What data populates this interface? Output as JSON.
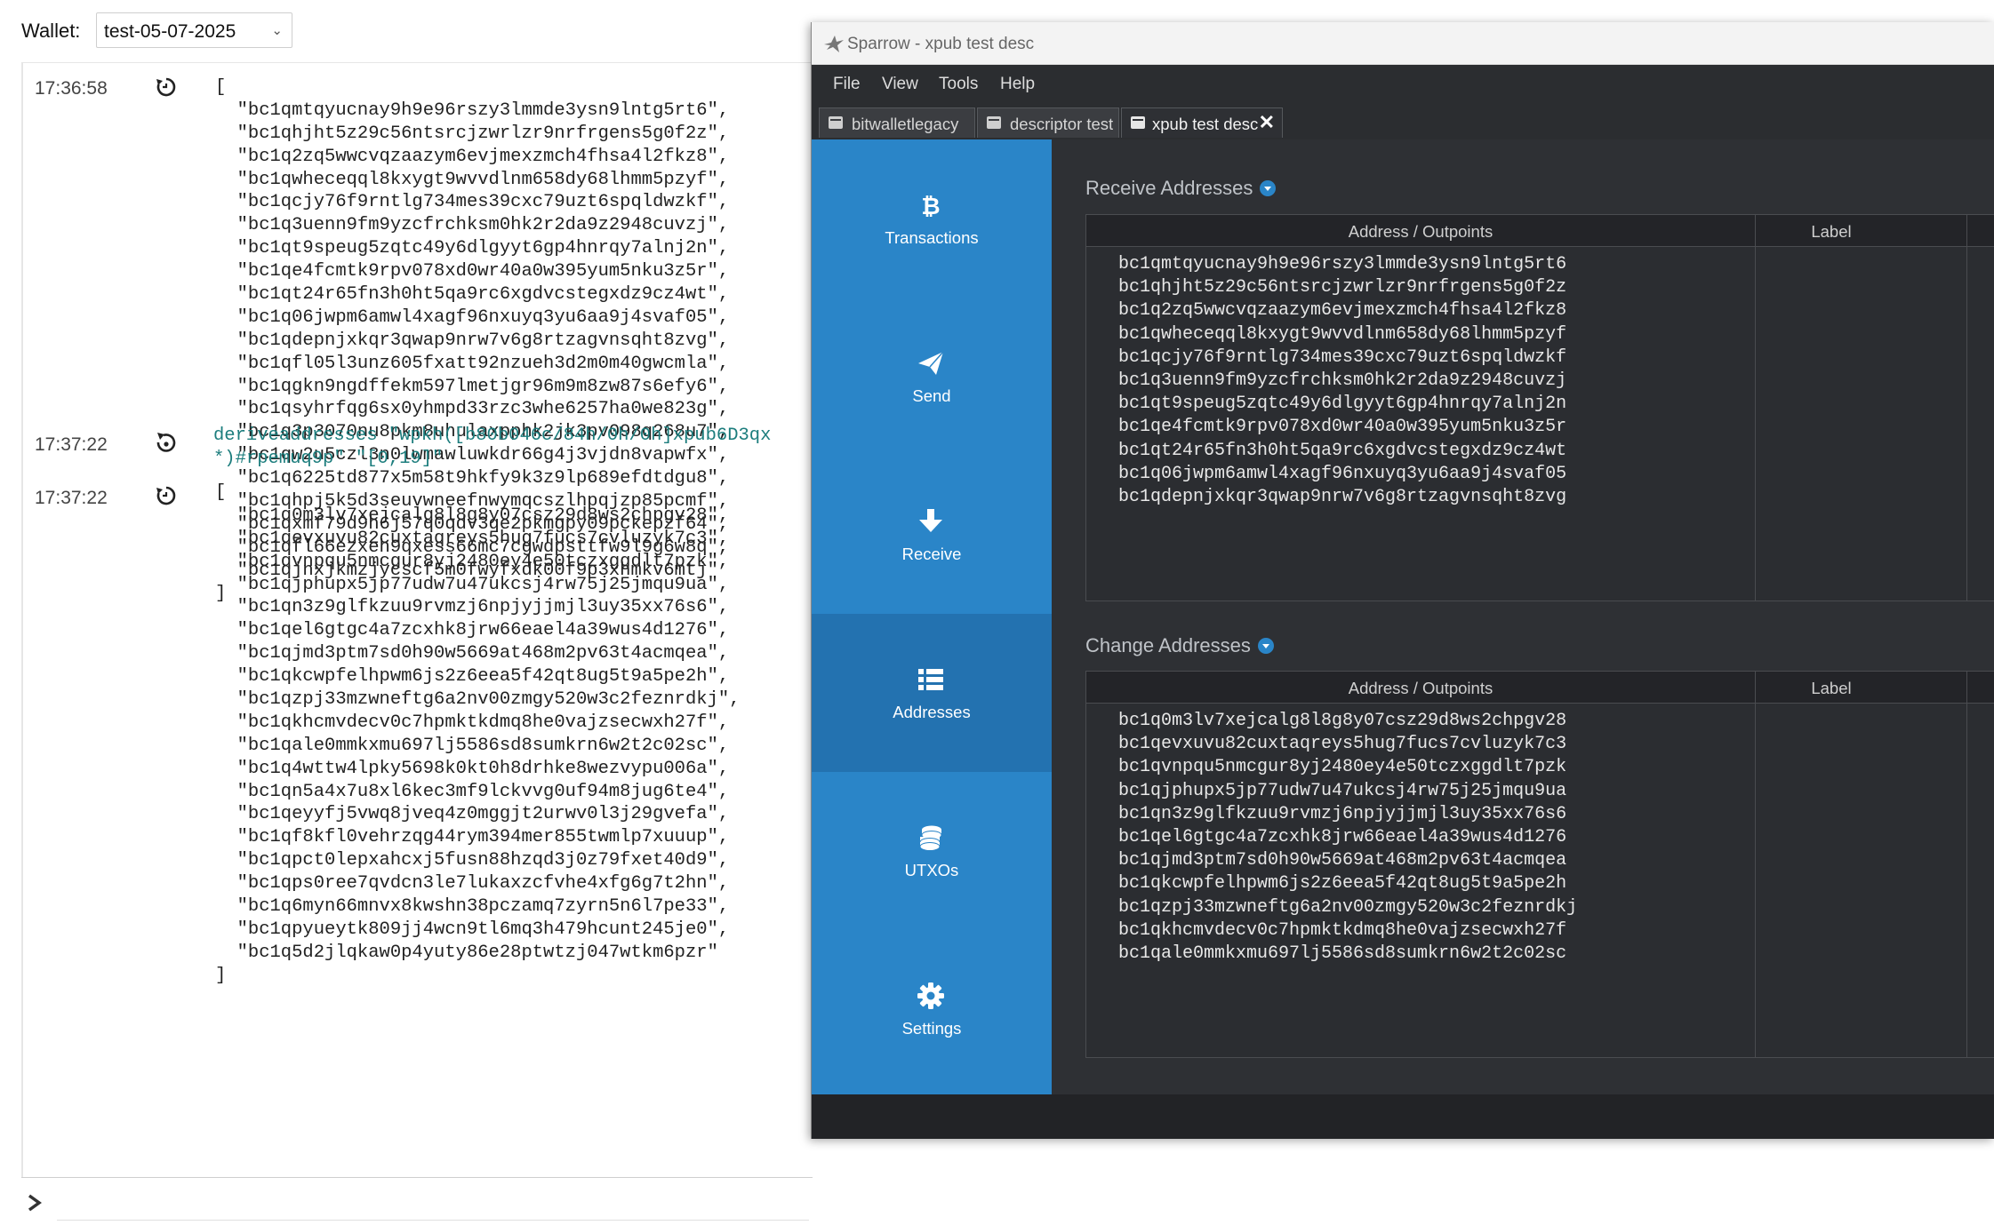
{
  "wallet_bar": {
    "label": "Wallet:",
    "selected_wallet": "test-05-07-2025"
  },
  "console": {
    "entries": [
      {
        "time": "17:36:58",
        "icon": "result-icon",
        "lines": [
          "[",
          "  \"bc1qmtqyucnay9h9e96rszy3lmmde3ysn9lntg5rt6\",",
          "  \"bc1qhjht5z29c56ntsrcjzwrlzr9nrfrgens5g0f2z\",",
          "  \"bc1q2zq5wwcvqzaazym6evjmexzmch4fhsa4l2fkz8\",",
          "  \"bc1qwheceqql8kxygt9wvvdlnm658dy68lhmm5pzyf\",",
          "  \"bc1qcjy76f9rntlg734mes39cxc79uzt6spqldwzkf\",",
          "  \"bc1q3uenn9fm9yzcfrchksm0hk2r2da9z2948cuvzj\",",
          "  \"bc1qt9speug5zqtc49y6dlgyyt6gp4hnrqy7alnj2n\",",
          "  \"bc1qe4fcmtk9rpv078xd0wr40a0w395yum5nku3z5r\",",
          "  \"bc1qt24r65fn3h0ht5qa9rc6xgdvcstegxdz9cz4wt\",",
          "  \"bc1q06jwpm6amwl4xagf96nxuyq3yu6aa9j4svaf05\",",
          "  \"bc1qdepnjxkqr3qwap9nrw7v6g8rtzagvnsqht8zvg\",",
          "  \"bc1qfl05l3unz605fxatt92nzueh3d2m0m40gwcmla\",",
          "  \"bc1qgkn9ngdffekm597lmetjgr96m9m8zw87s6efy6\",",
          "  \"bc1qsyhrfqg6sx0yhmpd33rzc3whe6257ha0we823g\",",
          "  \"bc1q3p3070nu8pkm8uhulaxpphk2jk3pv098q268u7\",",
          "  \"bc1qw2u5czl3n0lwmawluwkdr66g4j3vjdn8vapwfx\",",
          "  \"bc1q6225td877x5m58t9hkfy9k3z9lp689efdtdgu8\",",
          "  \"bc1qhpj5k5d3seuvwneefnwymqcszlhpqjzp85pcmf\",",
          "  \"bc1qxmf79d9h6j57q0qdv3qe2pkmgpy09pckepzf64\",",
          "  \"bc1qfl66ezxeh9qxess66mc7cgwdpsttfw9l9g6w8q\",",
          "  \"bc1qjnxjkmzjycscf5m0fwyfxdk00f9p3xhmkv6mtj\"",
          "]"
        ]
      },
      {
        "time": "17:37:22",
        "icon": "command-icon",
        "command_lines": [
          "deriveaddresses \"wpkh([b80b046c/84h/0h/0h]xpub6D3qx",
          "*)#rpemuq9p\" \"[0,19]\""
        ]
      },
      {
        "time": "17:37:22",
        "icon": "result-icon",
        "lines": [
          "[",
          "  \"bc1q0m3lv7xejcalg8l8g8y07csz29d8ws2chpgv28\",",
          "  \"bc1qevxuvu82cuxtaqreys5hug7fucs7cvluzyk7c3\",",
          "  \"bc1qvnpqu5nmcgur8yj2480ey4e50tczxggdlt7pzk\",",
          "  \"bc1qjphupx5jp77udw7u47ukcsj4rw75j25jmqu9ua\",",
          "  \"bc1qn3z9glfkzuu9rvmzj6npjyjjmjl3uy35xx76s6\",",
          "  \"bc1qel6gtgc4a7zcxhk8jrw66eael4a39wus4d1276\",",
          "  \"bc1qjmd3ptm7sd0h90w5669at468m2pv63t4acmqea\",",
          "  \"bc1qkcwpfelhpwm6js2z6eea5f42qt8ug5t9a5pe2h\",",
          "  \"bc1qzpj33mzwneftg6a2nv00zmgy520w3c2feznrdkj\",",
          "  \"bc1qkhcmvdecv0c7hpmktkdmq8he0vajzsecwxh27f\",",
          "  \"bc1qale0mmkxmu697lj5586sd8sumkrn6w2t2c02sc\",",
          "  \"bc1q4wttw4lpky5698k0kt0h8drhke8wezvypu006a\",",
          "  \"bc1qn5a4x7u8xl6kec3mf9lckvvg0uf94m8jug6te4\",",
          "  \"bc1qeyyfj5vwq8jveq4z0mggjt2urwv0l3j29gvefa\",",
          "  \"bc1qf8kfl0vehrzqg44rym394mer855twmlp7xuuup\",",
          "  \"bc1qpct0lepxahcxj5fusn88hzqd3j0z79fxet40d9\",",
          "  \"bc1qps0ree7qvdcn3le7lukaxzcfvhe4xfg6g7t2hn\",",
          "  \"bc1q6myn66mnvx8kwshn38pczamq7zyrn5n6l7pe33\",",
          "  \"bc1qpyueytk809jj4wcn9tl6mq3h479hcunt245je0\",",
          "  \"bc1q5d2jlqkaw0p4yuty86e28ptwtzj047wtkm6pzr\"",
          "]"
        ]
      }
    ],
    "input_placeholder": ""
  },
  "sparrow": {
    "window_title": "Sparrow - xpub test desc",
    "menu": [
      "File",
      "View",
      "Tools",
      "Help"
    ],
    "tabs": [
      {
        "label": "bitwalletlegacy",
        "active": false
      },
      {
        "label": "descriptor test",
        "active": false
      },
      {
        "label": "xpub test desc",
        "active": true
      }
    ],
    "sidebar": [
      {
        "label": "Transactions",
        "icon": "bitcoin-icon"
      },
      {
        "label": "Send",
        "icon": "send-icon"
      },
      {
        "label": "Receive",
        "icon": "receive-icon"
      },
      {
        "label": "Addresses",
        "icon": "list-icon",
        "active": true
      },
      {
        "label": "UTXOs",
        "icon": "coins-icon"
      },
      {
        "label": "Settings",
        "icon": "gear-icon"
      }
    ],
    "receive": {
      "title": "Receive Addresses",
      "col_address": "Address / Outpoints",
      "col_label": "Label",
      "rows": [
        "bc1qmtqyucnay9h9e96rszy3lmmde3ysn9lntg5rt6",
        "bc1qhjht5z29c56ntsrcjzwrlzr9nrfrgens5g0f2z",
        "bc1q2zq5wwcvqzaazym6evjmexzmch4fhsa4l2fkz8",
        "bc1qwheceqql8kxygt9wvvdlnm658dy68lhmm5pzyf",
        "bc1qcjy76f9rntlg734mes39cxc79uzt6spqldwzkf",
        "bc1q3uenn9fm9yzcfrchksm0hk2r2da9z2948cuvzj",
        "bc1qt9speug5zqtc49y6dlgyyt6gp4hnrqy7alnj2n",
        "bc1qe4fcmtk9rpv078xd0wr40a0w395yum5nku3z5r",
        "bc1qt24r65fn3h0ht5qa9rc6xgdvcstegxdz9cz4wt",
        "bc1q06jwpm6amwl4xagf96nxuyq3yu6aa9j4svaf05",
        "bc1qdepnjxkqr3qwap9nrw7v6g8rtzagvnsqht8zvg"
      ]
    },
    "change": {
      "title": "Change Addresses",
      "col_address": "Address / Outpoints",
      "col_label": "Label",
      "rows": [
        "bc1q0m3lv7xejcalg8l8g8y07csz29d8ws2chpgv28",
        "bc1qevxuvu82cuxtaqreys5hug7fucs7cvluzyk7c3",
        "bc1qvnpqu5nmcgur8yj2480ey4e50tczxggdlt7pzk",
        "bc1qjphupx5jp77udw7u47ukcsj4rw75j25jmqu9ua",
        "bc1qn3z9glfkzuu9rvmzj6npjyjjmjl3uy35xx76s6",
        "bc1qel6gtgc4a7zcxhk8jrw66eael4a39wus4d1276",
        "bc1qjmd3ptm7sd0h90w5669at468m2pv63t4acmqea",
        "bc1qkcwpfelhpwm6js2z6eea5f42qt8ug5t9a5pe2h",
        "bc1qzpj33mzwneftg6a2nv00zmgy520w3c2feznrdkj",
        "bc1qkhcmvdecv0c7hpmktkdmq8he0vajzsecwxh27f",
        "bc1qale0mmkxmu697lj5586sd8sumkrn6w2t2c02sc"
      ]
    }
  },
  "colors": {
    "sidebar_blue": "#2a85c8",
    "sidebar_active": "#2372b0",
    "dark_bg": "#2e3034",
    "console_teal": "#1c7d7d"
  }
}
